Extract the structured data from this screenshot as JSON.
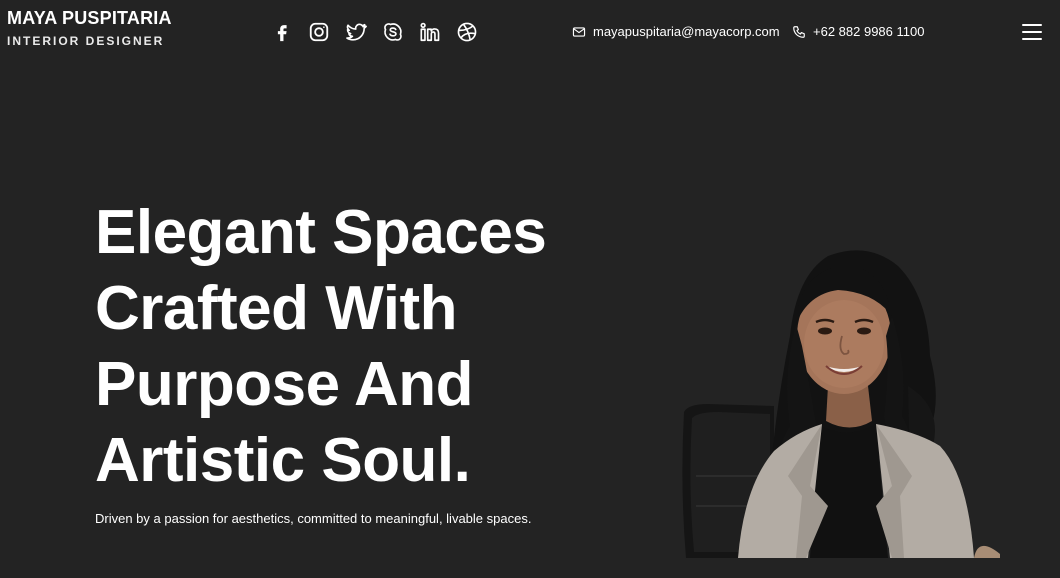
{
  "brand": {
    "name": "MAYA PUSPITARIA",
    "role": "INTERIOR DESIGNER"
  },
  "socials": [
    {
      "icon": "facebook-icon"
    },
    {
      "icon": "instagram-icon"
    },
    {
      "icon": "twitter-icon"
    },
    {
      "icon": "skype-icon"
    },
    {
      "icon": "linkedin-icon"
    },
    {
      "icon": "dribbble-icon"
    }
  ],
  "contact": {
    "email": "mayapuspitaria@mayacorp.com",
    "phone": "+62 882 9986 1100"
  },
  "hero": {
    "title": "Elegant Spaces\nCrafted With\nPurpose And\nArtistic Soul.",
    "subtitle": "Driven by a passion for aesthetics, committed to meaningful, livable spaces."
  },
  "colors": {
    "background": "#232323",
    "text": "#ffffff",
    "blazer": "#b3aca4",
    "chair": "#1a1a1a"
  }
}
